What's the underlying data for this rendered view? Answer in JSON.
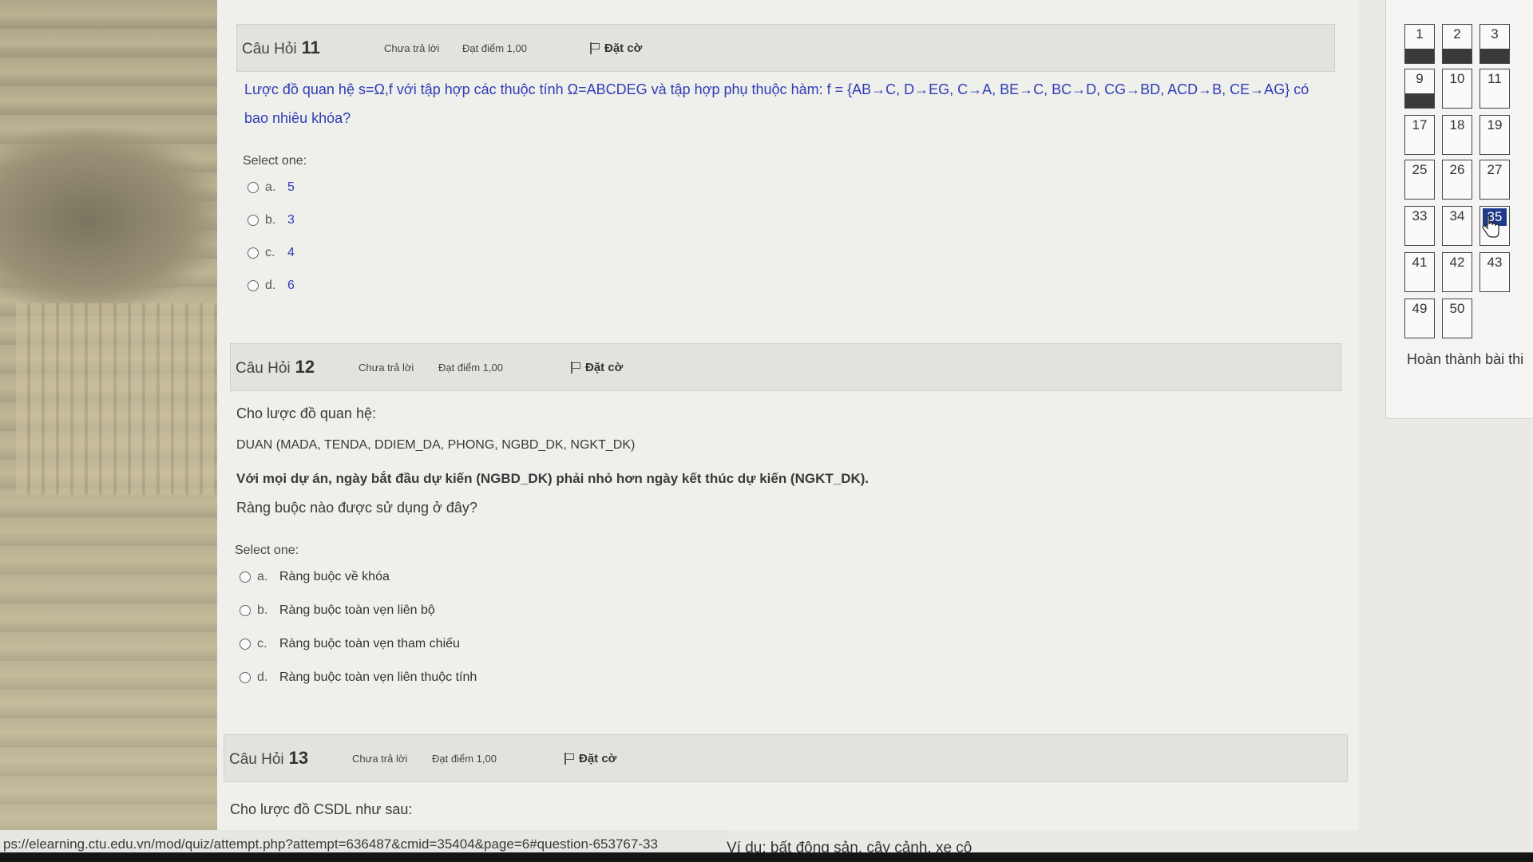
{
  "questions": [
    {
      "label": "Câu Hỏi",
      "number": "11",
      "status": "Chưa trả lời",
      "grade": "Đạt điểm 1,00",
      "flag": "Đặt cờ",
      "text_line1": "Lược đồ quan hệ s=Ω,f với tập hợp các thuộc tính Ω=ABCDEG và tập hợp phụ thuộc hàm: f = {AB→C, D→EG, C→A, BE→C, BC→D, CG→BD, ACD→B, CE→AG} có",
      "text_line2": "bao nhiêu khóa?",
      "select_one": "Select one:",
      "options": [
        {
          "letter": "a.",
          "value": "5"
        },
        {
          "letter": "b.",
          "value": "3"
        },
        {
          "letter": "c.",
          "value": "4"
        },
        {
          "letter": "d.",
          "value": "6"
        }
      ]
    },
    {
      "label": "Câu Hỏi",
      "number": "12",
      "status": "Chưa trả lời",
      "grade": "Đạt điểm 1,00",
      "flag": "Đặt cờ",
      "intro": "Cho lược đồ quan hệ:",
      "schema": "DUAN (MADA, TENDA, DDIEM_DA, PHONG, NGBD_DK, NGKT_DK)",
      "constraint": "Với mọi dự án, ngày bắt đầu dự kiến (NGBD_DK) phải nhỏ hơn ngày kết thúc dự kiến (NGKT_DK).",
      "question": "Ràng buộc nào được sử dụng ở đây?",
      "select_one": "Select one:",
      "options": [
        {
          "letter": "a.",
          "value": "Ràng buộc về khóa"
        },
        {
          "letter": "b.",
          "value": "Ràng buộc toàn vẹn liên bộ"
        },
        {
          "letter": "c.",
          "value": "Ràng buộc toàn vẹn tham chiếu"
        },
        {
          "letter": "d.",
          "value": "Ràng buộc toàn vẹn liên thuộc tính"
        }
      ]
    },
    {
      "label": "Câu Hỏi",
      "number": "13",
      "status": "Chưa trả lời",
      "grade": "Đạt điểm 1,00",
      "flag": "Đặt cờ",
      "intro": "Cho lược đồ CSDL như sau:"
    }
  ],
  "navigation": {
    "rows": [
      [
        "1",
        "2",
        "3"
      ],
      [
        "9",
        "10",
        "11"
      ],
      [
        "17",
        "18",
        "19"
      ],
      [
        "25",
        "26",
        "27"
      ],
      [
        "33",
        "34",
        "35"
      ],
      [
        "41",
        "42",
        "43"
      ],
      [
        "49",
        "50"
      ]
    ],
    "answered": [
      "1",
      "2",
      "3",
      "9"
    ],
    "current": "35",
    "finish_label": "Hoàn thành bài thi"
  },
  "status_bar": {
    "url": "ps://elearning.ctu.edu.vn/mod/quiz/attempt.php?attempt=636487&cmid=35404&page=6#question-653767-33",
    "trailing_text": "Ví dụ: bất động sản, cây cảnh, xe cộ"
  },
  "colors": {
    "question_text_blue": "#2f3db5",
    "nav_current": "#1e3a8a",
    "nav_answered_bar": "#3a3a3a"
  },
  "icons": [
    "flag-icon",
    "hand-cursor-icon"
  ]
}
